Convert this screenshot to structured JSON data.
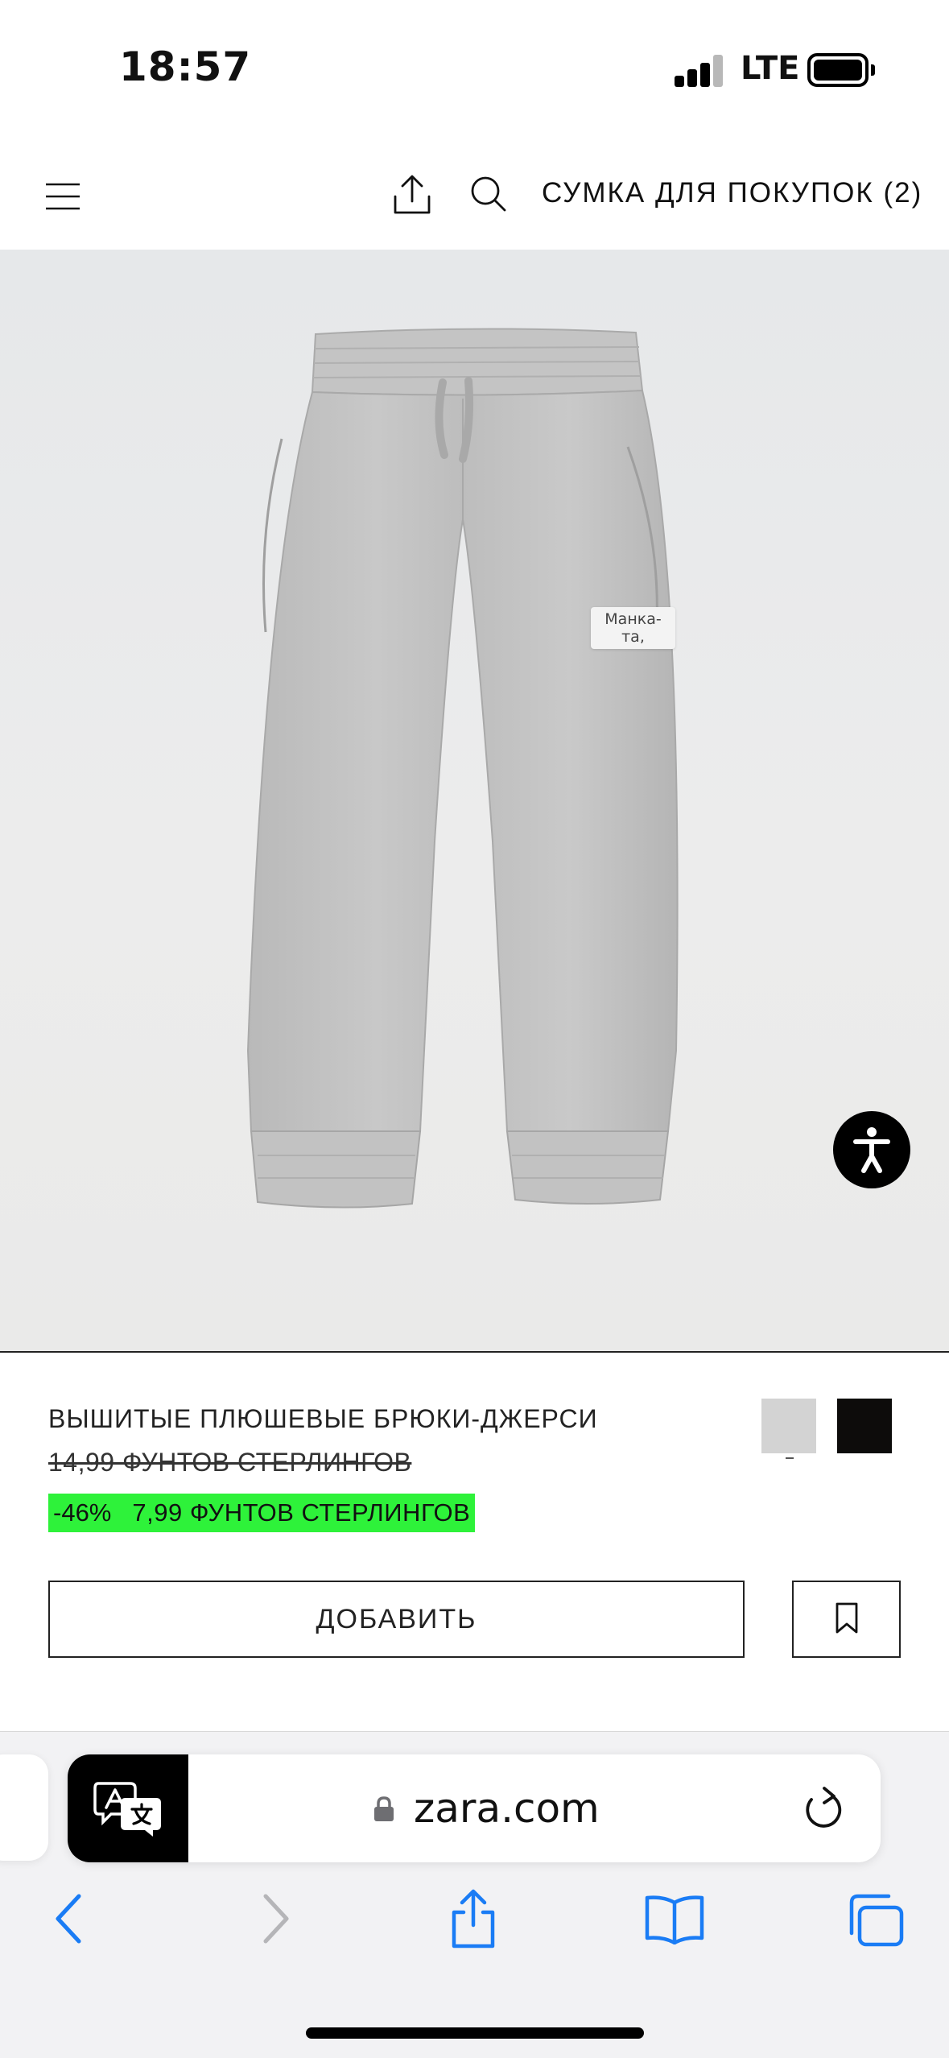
{
  "status_bar": {
    "time": "18:57",
    "network": "LTE"
  },
  "header": {
    "menu_icon": "hamburger-menu-icon",
    "share_icon": "share-icon",
    "search_icon": "search-icon",
    "bag_label": "СУМКА ДЛЯ ПОКУПОК (2)"
  },
  "product_image": {
    "tag_text_line1": "Манка-",
    "tag_text_line2": "та,",
    "accessibility_icon": "accessibility-icon"
  },
  "product": {
    "name": "ВЫШИТЫЕ ПЛЮШЕВЫЕ БРЮКИ-ДЖЕРСИ",
    "old_price": "14,99 ФУНТОВ СТЕРЛИНГОВ",
    "discount": "-46%",
    "sale_price": "7,99 ФУНТОВ СТЕРЛИНГОВ",
    "colors": [
      "#d3d3d3",
      "#0d0c0b"
    ],
    "sale_highlight_color": "#2ef23a",
    "add_label": "ДОБАВИТЬ",
    "bookmark_icon": "bookmark-icon"
  },
  "browser": {
    "url": "zara.com",
    "translate_icon": "translate-icon",
    "lock_icon": "lock-icon",
    "reload_icon": "reload-icon",
    "toolbar": [
      "back-icon",
      "forward-icon",
      "share-icon",
      "bookmarks-icon",
      "tabs-icon"
    ],
    "accent_color": "#1a7cf5"
  }
}
